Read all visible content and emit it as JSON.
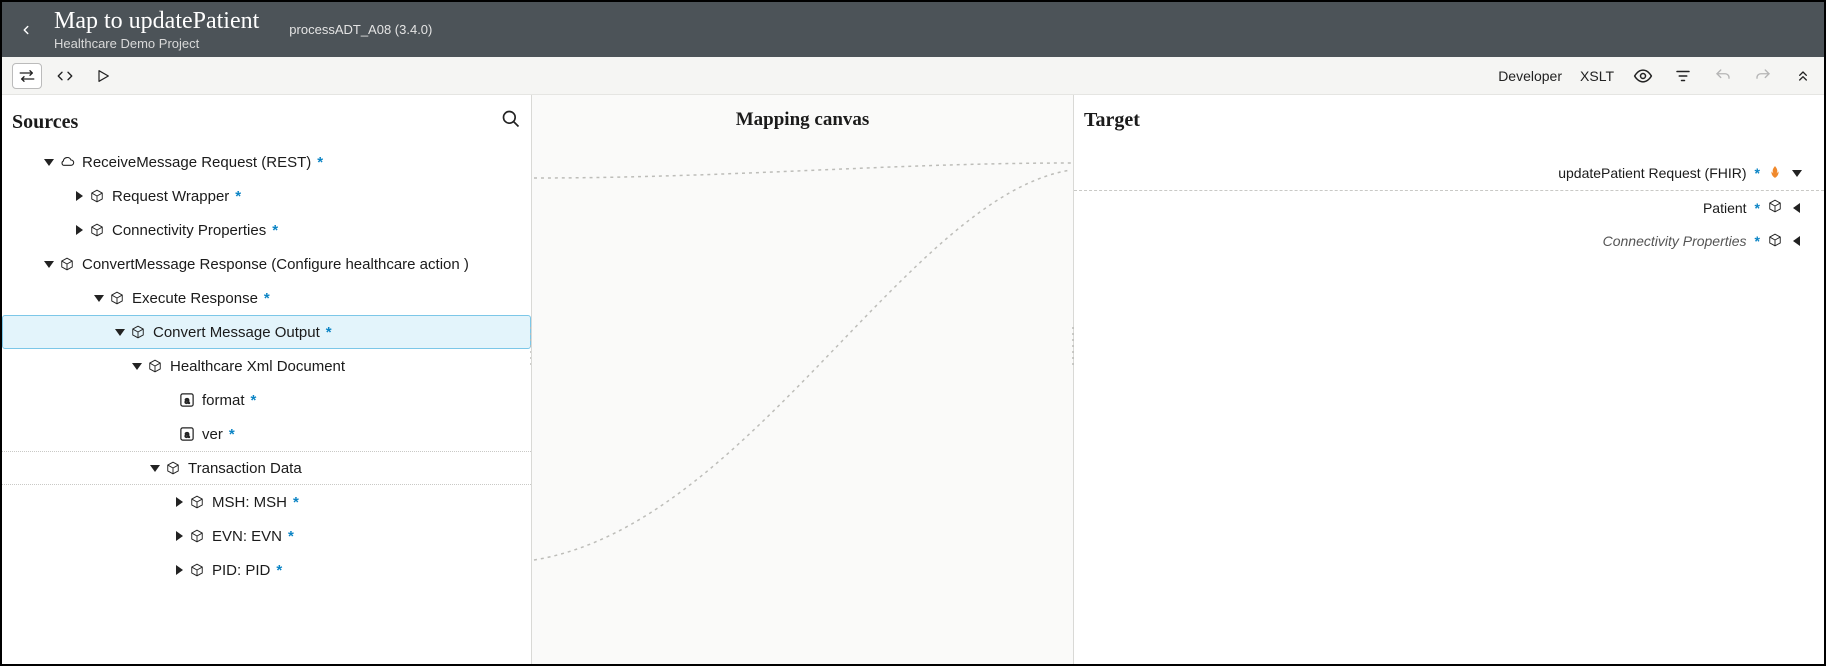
{
  "header": {
    "title": "Map to updatePatient",
    "subtitle": "Healthcare Demo Project",
    "meta": "processADT_A08 (3.4.0)"
  },
  "toolbar": {
    "developer": "Developer",
    "xslt": "XSLT"
  },
  "panels": {
    "sources": "Sources",
    "canvas": "Mapping canvas",
    "target": "Target"
  },
  "sourceTree": {
    "n0": {
      "label": "ReceiveMessage Request (REST)"
    },
    "n1": {
      "label": "Request Wrapper"
    },
    "n2": {
      "label": "Connectivity Properties"
    },
    "n3": {
      "label": "ConvertMessage Response (Configure healthcare action )"
    },
    "n4": {
      "label": "Execute Response"
    },
    "n5": {
      "label": "Convert Message Output"
    },
    "n6": {
      "label": "Healthcare Xml Document"
    },
    "n7": {
      "label": "format"
    },
    "n8": {
      "label": "ver"
    },
    "n9": {
      "label": "Transaction Data"
    },
    "n10": {
      "label": "MSH: MSH"
    },
    "n11": {
      "label": "EVN: EVN"
    },
    "n12": {
      "label": "PID: PID"
    }
  },
  "targetTree": {
    "t0": {
      "label": "updatePatient Request (FHIR)"
    },
    "t1": {
      "label": "Patient"
    },
    "t2": {
      "label": "Connectivity Properties"
    }
  }
}
